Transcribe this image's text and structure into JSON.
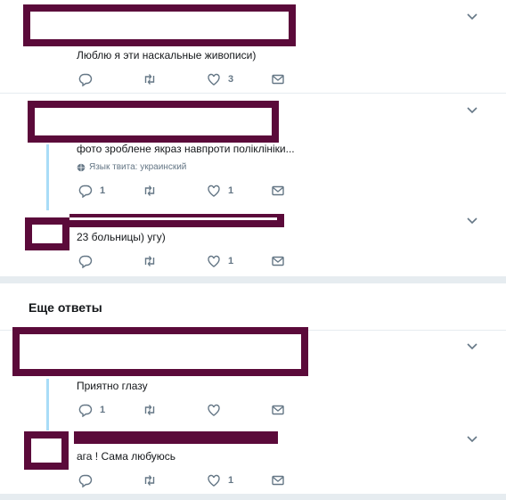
{
  "tweets": [
    {
      "text": "Люблю я эти наскальные живописи)",
      "reply_count": "",
      "like_count": "3",
      "lang": ""
    },
    {
      "text": "фото зроблене якраз навпроти поліклініки...",
      "reply_count": "1",
      "like_count": "1",
      "lang": "Язык твита: украинский"
    },
    {
      "text": "23 больницы) угу)",
      "reply_count": "",
      "like_count": "1",
      "lang": ""
    },
    {
      "text": "Приятно глазу",
      "reply_count": "1",
      "like_count": "",
      "lang": ""
    },
    {
      "text": "ага ! Сама любуюсь",
      "reply_count": "",
      "like_count": "1",
      "lang": ""
    }
  ],
  "more_replies_title": "Еще ответы",
  "icons": {
    "reply": "reply-icon",
    "retweet": "retweet-icon",
    "like": "heart-icon",
    "dm": "envelope-icon",
    "chevron": "chevron-down-icon",
    "globe": "globe-icon"
  },
  "colors": {
    "redaction": "#5b0a3a",
    "icon": "#657786",
    "thread_line": "#a9dcf7",
    "separator": "#e6ecf0"
  }
}
